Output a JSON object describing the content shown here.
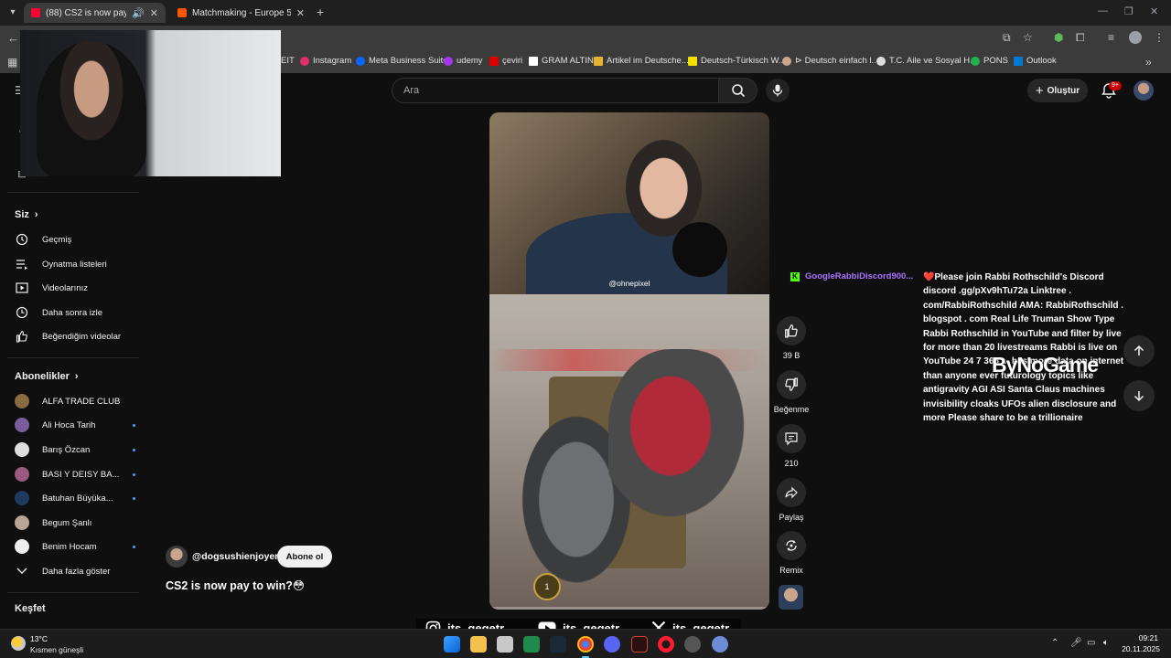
{
  "browser": {
    "tabs": [
      {
        "title": "(88) CS2 is now pay to win?",
        "active": true,
        "favicon_color": "#ff0033"
      },
      {
        "title": "Matchmaking - Europe 5v5 Qu...",
        "active": false,
        "favicon_color": "#ff5500"
      }
    ],
    "new_tab_icon": "plus-icon"
  },
  "bookmarks": [
    {
      "label": "EIT",
      "icon": "bookmark-icon"
    },
    {
      "label": "Instagram",
      "icon": "instagram-icon",
      "color": "#e1306c"
    },
    {
      "label": "Meta Business Suite",
      "icon": "meta-icon",
      "color": "#0866ff"
    },
    {
      "label": "udemy",
      "icon": "udemy-icon",
      "color": "#a435f0"
    },
    {
      "label": "çeviri",
      "icon": "flag-icon",
      "color": "#dd0000"
    },
    {
      "label": "GRAM ALTIN",
      "icon": "tradingview-icon",
      "color": "#ffffff"
    },
    {
      "label": "Artikel im Deutsche...",
      "icon": "folder-icon",
      "color": "#e8b430"
    },
    {
      "label": "Deutsch-Türkisch W...",
      "icon": "dictionary-icon",
      "color": "#f2e100"
    },
    {
      "label": "⊳ Deutsch einfach l...",
      "icon": "avatar-icon",
      "color": "#c9a58d"
    },
    {
      "label": "T.C. Aile ve Sosyal H...",
      "icon": "gov-icon",
      "color": "#dddddd"
    },
    {
      "label": "PONS",
      "icon": "pons-icon",
      "color": "#22b14c"
    },
    {
      "label": "Outlook",
      "icon": "outlook-icon",
      "color": "#0078d4"
    }
  ],
  "header": {
    "search_placeholder": "Ara",
    "create_label": "Oluştur",
    "notification_badge": "9+"
  },
  "sidebar": {
    "you_title": "Siz",
    "you_items": [
      {
        "label": "Geçmiş",
        "icon": "history-icon"
      },
      {
        "label": "Oynatma listeleri",
        "icon": "playlist-icon"
      },
      {
        "label": "Videolarınız",
        "icon": "your-videos-icon"
      },
      {
        "label": "Daha sonra izle",
        "icon": "watch-later-icon"
      },
      {
        "label": "Beğendiğim videolar",
        "icon": "liked-videos-icon"
      }
    ],
    "subs_title": "Abonelikler",
    "subscriptions": [
      {
        "label": "ALFA TRADE CLUB",
        "live": false,
        "color": "#8a6a40"
      },
      {
        "label": "Ali Hoca Tarih",
        "live": true,
        "color": "#7a5e9c"
      },
      {
        "label": "Barış Özcan",
        "live": true,
        "color": "#dddddd"
      },
      {
        "label": "BASI Y DEISY BA...",
        "live": true,
        "color": "#9a5a80"
      },
      {
        "label": "Batuhan Büyüka...",
        "live": true,
        "color": "#1f3a5f"
      },
      {
        "label": "Begum Şanlı",
        "live": false,
        "color": "#b7a596"
      },
      {
        "label": "Benim Hocam",
        "live": true,
        "color": "#eeeeee"
      }
    ],
    "more_label": "Daha fazla göster",
    "explore_title": "Keşfet"
  },
  "video": {
    "streamer_handle": "@ohnepixel",
    "channel_handle": "@dogsushienjoyer",
    "subscribe_label": "Abone ol",
    "title": "CS2 is now pay to win?😳",
    "progress": 0.0,
    "rank_number": "1"
  },
  "actions": {
    "likes": "39 B",
    "dislike_label": "Beğenme",
    "comments": "210",
    "share_label": "Paylaş",
    "remix_label": "Remix"
  },
  "chat": {
    "username": "GoogleRabbiDiscord900...",
    "message": "❤️Please join Rabbi Rothschild's Discord discord .gg/pXv9hTu72a Linktree . com/RabbiRothschild AMA: RabbiRothschild . blogspot . com Real Life Truman Show Type Rabbi Rothschild in YouTube and filter by live for more than 20 livestreams Rabbi is live on YouTube 24 7 365 ... has more data on internet than anyone ever futurology topics like antigravity AGI ASI Santa Claus machines invisibility cloaks UFOs alien disclosure and more Please share to be a trillionaire",
    "watermark": "ByNoGame"
  },
  "socials": [
    {
      "icon": "instagram-icon",
      "handle": "its_gegetr"
    },
    {
      "icon": "youtube-icon",
      "handle": "its_gegetr"
    },
    {
      "icon": "x-icon",
      "handle": "its_gegetr"
    }
  ],
  "taskbar": {
    "temperature": "13°C",
    "weather": "Kısmen güneşli",
    "time": "09:21",
    "date": "20.11.2025"
  },
  "colors": {
    "background": "#0f0f0f",
    "accent_red": "#ff0000",
    "chat_username": "#a974ff"
  }
}
